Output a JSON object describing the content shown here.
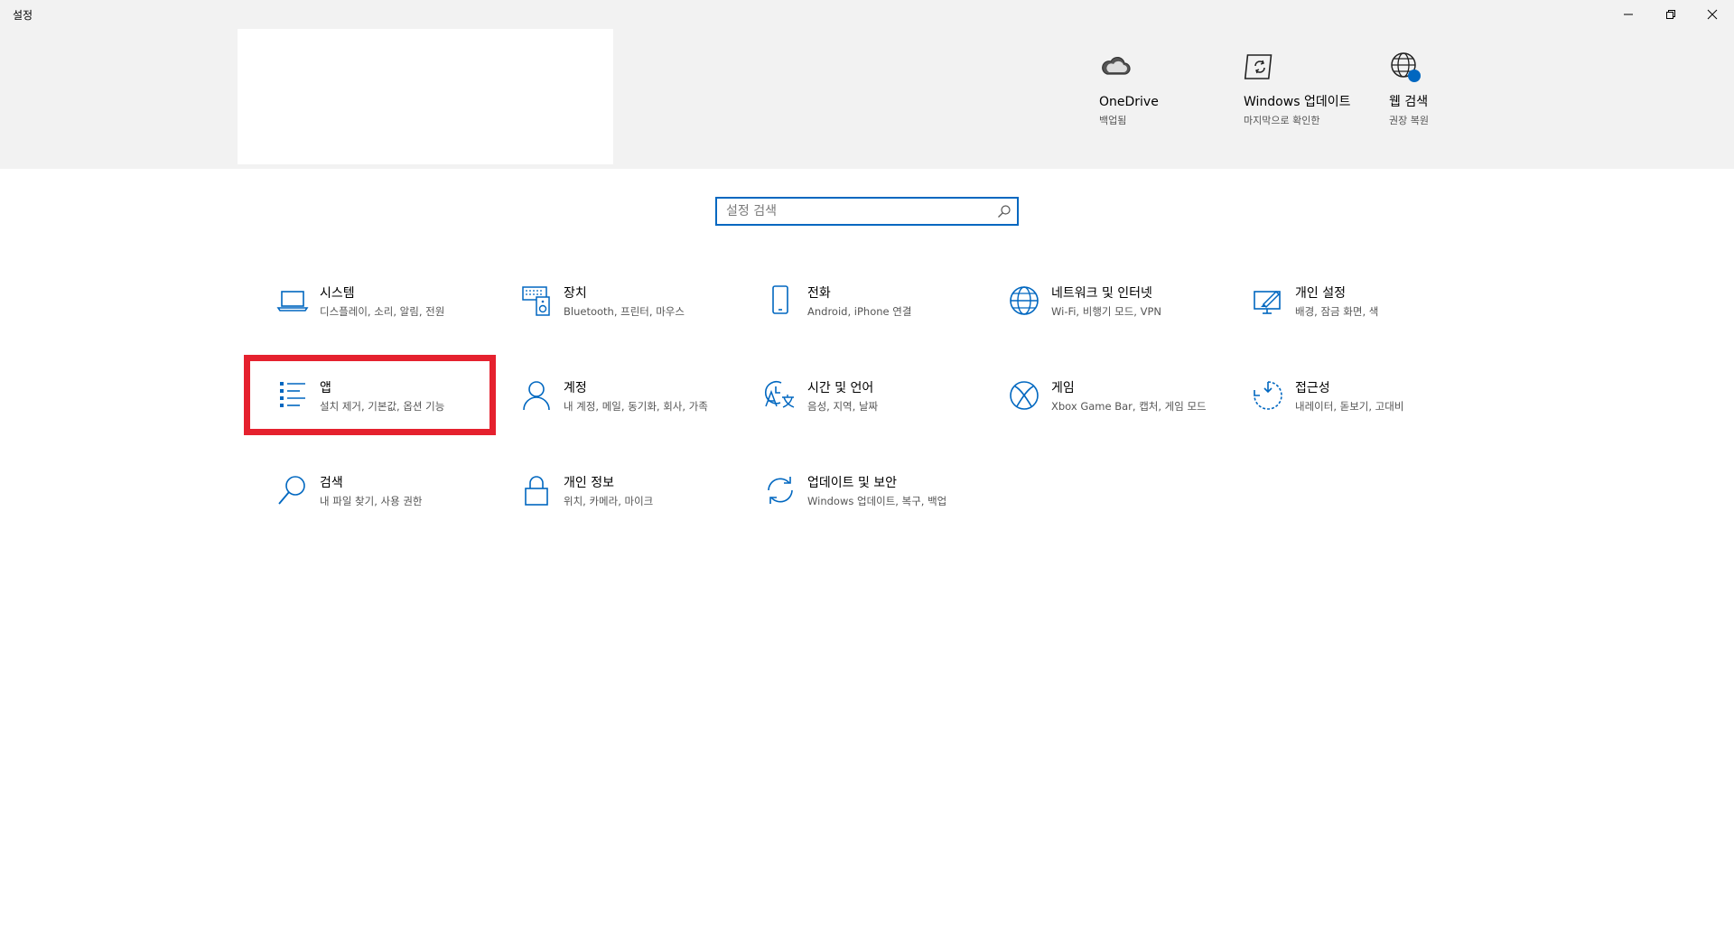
{
  "window": {
    "title": "설정",
    "controls": [
      "minimize",
      "maximize",
      "close"
    ]
  },
  "quick_links": [
    {
      "name": "onedrive",
      "title": "OneDrive",
      "subtitle": "백업됨",
      "icon": "cloud-icon"
    },
    {
      "name": "windows-update",
      "title": "Windows 업데이트",
      "subtitle": "마지막으로 확인한",
      "icon": "update-icon"
    },
    {
      "name": "web-search",
      "title": "웹 검색",
      "subtitle": "권장 복원",
      "icon": "globe-icon"
    }
  ],
  "search": {
    "placeholder": "설정 검색",
    "value": ""
  },
  "categories": [
    {
      "name": "system",
      "title": "시스템",
      "desc": "디스플레이, 소리, 알림, 전원",
      "icon": "laptop-icon"
    },
    {
      "name": "devices",
      "title": "장치",
      "desc": "Bluetooth, 프린터, 마우스",
      "icon": "keyboard-speaker-icon"
    },
    {
      "name": "phone",
      "title": "전화",
      "desc": "Android, iPhone 연결",
      "icon": "phone-icon"
    },
    {
      "name": "network",
      "title": "네트워크 및 인터넷",
      "desc": "Wi-Fi, 비행기 모드, VPN",
      "icon": "globe-icon"
    },
    {
      "name": "personalization",
      "title": "개인 설정",
      "desc": "배경, 잠금 화면, 색",
      "icon": "monitor-pen-icon"
    },
    {
      "name": "apps",
      "title": "앱",
      "desc": "설치 제거, 기본값, 옵션 기능",
      "icon": "list-icon"
    },
    {
      "name": "accounts",
      "title": "계정",
      "desc": "내 계정, 메일, 동기화, 회사, 가족",
      "icon": "person-icon"
    },
    {
      "name": "time-language",
      "title": "시간 및 언어",
      "desc": "음성, 지역, 날짜",
      "icon": "time-language-icon"
    },
    {
      "name": "gaming",
      "title": "게임",
      "desc": "Xbox Game Bar, 캡처, 게임 모드",
      "icon": "xbox-icon"
    },
    {
      "name": "ease-of-access",
      "title": "접근성",
      "desc": "내레이터, 돋보기, 고대비",
      "icon": "accessibility-icon"
    },
    {
      "name": "search",
      "title": "검색",
      "desc": "내 파일 찾기, 사용 권한",
      "icon": "search-icon"
    },
    {
      "name": "privacy",
      "title": "개인 정보",
      "desc": "위치, 카메라, 마이크",
      "icon": "lock-icon"
    },
    {
      "name": "update-security",
      "title": "업데이트 및 보안",
      "desc": "Windows 업데이트, 복구, 백업",
      "icon": "sync-icon"
    }
  ],
  "colors": {
    "accent": "#0067c0",
    "highlight": "#e5212e",
    "header_bg": "#f2f2f2"
  }
}
